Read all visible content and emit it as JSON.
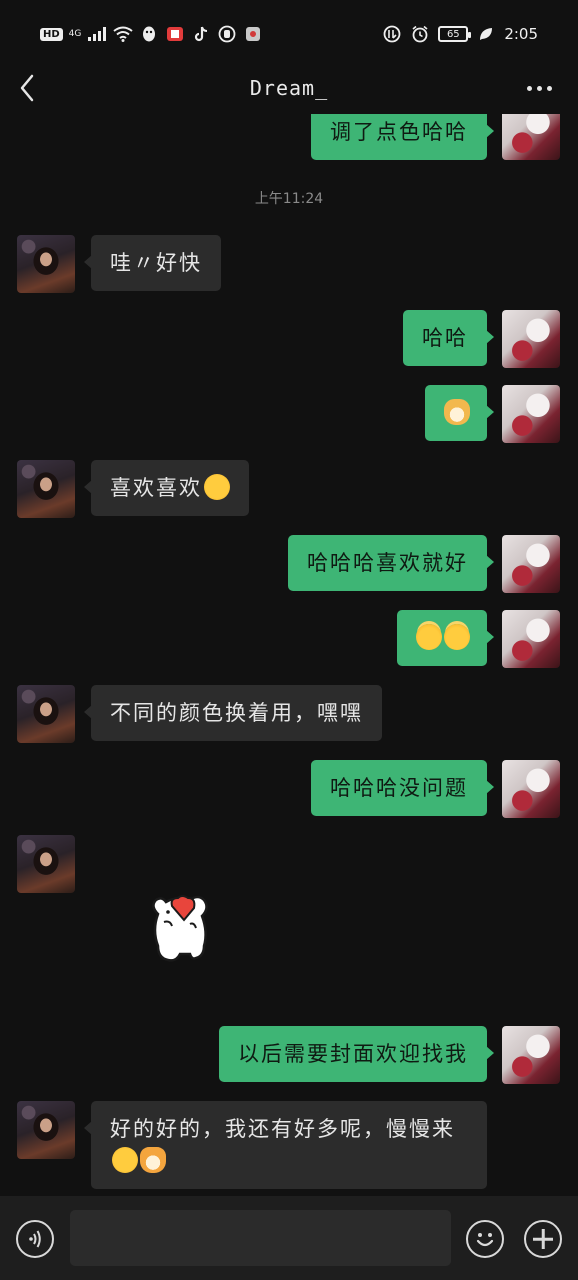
{
  "status_bar": {
    "hd": "HD",
    "network": "4G",
    "battery": "65",
    "time": "2:05"
  },
  "header": {
    "title": "Dream_",
    "back_icon": "chevron-left-icon",
    "more_icon": "more-dots-icon"
  },
  "chat": {
    "timestamp": "上午11:24",
    "messages": [
      {
        "side": "out",
        "text": "调了点色哈哈"
      },
      {
        "side": "in",
        "text": "哇〃好快"
      },
      {
        "side": "out",
        "text": "哈哈"
      },
      {
        "side": "out",
        "text": "",
        "emoji": [
          "dog-face-emoji"
        ]
      },
      {
        "side": "in",
        "text": "喜欢喜欢",
        "emoji": [
          "kissing-face-emoji"
        ]
      },
      {
        "side": "out",
        "text": "哈哈哈喜欢就好"
      },
      {
        "side": "out",
        "text": "",
        "emoji": [
          "halo-face-emoji",
          "halo-face-emoji"
        ]
      },
      {
        "side": "in",
        "text": "不同的颜色换着用，嘿嘿"
      },
      {
        "side": "out",
        "text": "哈哈哈没问题"
      },
      {
        "side": "in",
        "text": "",
        "sticker": "bear-holding-heart-sticker"
      },
      {
        "side": "out",
        "text": "以后需要封面欢迎找我"
      },
      {
        "side": "in",
        "text": "好的好的，我还有好多呢，慢慢来",
        "emoji": [
          "grinning-face-emoji",
          "cat-face-emoji"
        ]
      }
    ]
  },
  "input_bar": {
    "voice_icon": "voice-icon",
    "text_value": "",
    "emoji_icon": "emoji-icon",
    "plus_icon": "plus-icon"
  },
  "colors": {
    "background": "#111111",
    "outgoing_bubble": "#3eb575",
    "incoming_bubble": "#2c2c2c"
  }
}
